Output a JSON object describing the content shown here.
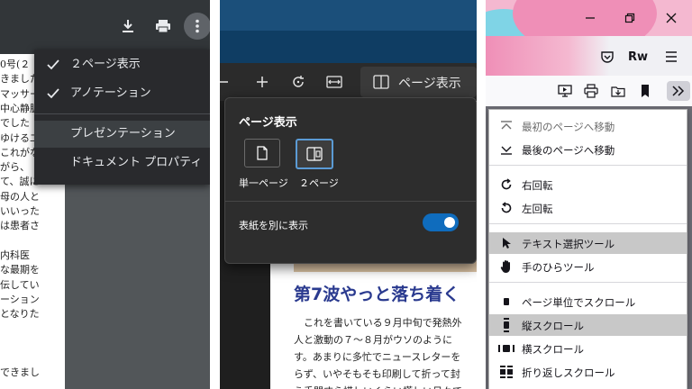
{
  "chrome_viewer": {
    "menu_items": [
      {
        "label": "２ページ表示",
        "checked": true
      },
      {
        "label": "アノテーション",
        "checked": true
      },
      {
        "label": "プレゼンテーション",
        "checked": false
      },
      {
        "label": "ドキュメント プロパティ",
        "checked": false
      }
    ],
    "doc_lines": [
      "0号(２",
      "きました",
      "マッサー",
      "中心静脈",
      "でした",
      "ゆける二",
      "これがな",
      "がら、",
      "て、誠に",
      "母の人と",
      "いいった",
      "は患者さ",
      "",
      "内科医",
      "な最期を",
      "伝してい",
      "ーション",
      "となりた",
      "",
      "",
      "",
      "できまし"
    ]
  },
  "edge_viewer": {
    "flyout_title": "ページ表示",
    "options": [
      {
        "label": "単一ページ",
        "selected": false
      },
      {
        "label": "２ページ",
        "selected": true
      }
    ],
    "cover_label": "表紙を別に表示",
    "cover_toggle_on": true,
    "toolbar_button_label": "ページ表示",
    "headline": "第7波やっと落ち着く",
    "doc_lines": [
      "　これを書いている９月中旬で発熱外",
      "人と激動の７～８月がウソのように",
      "す。あまりに多忙でニュースレターを",
      "らず、いやそもそも印刷して折って封",
      "う手間すら惜しいくらい慌しい日々で"
    ]
  },
  "firefox_viewer": {
    "menu_items": [
      {
        "label": "最初のページへ移動",
        "icon": "first-page-icon",
        "disabled": true,
        "highlighted": false
      },
      {
        "label": "最後のページへ移動",
        "icon": "last-page-icon",
        "disabled": false,
        "highlighted": false
      },
      {
        "label": "右回転",
        "icon": "rotate-cw-icon",
        "disabled": false,
        "highlighted": false
      },
      {
        "label": "左回転",
        "icon": "rotate-ccw-icon",
        "disabled": false,
        "highlighted": false
      },
      {
        "label": "テキスト選択ツール",
        "icon": "cursor-icon",
        "disabled": false,
        "highlighted": true
      },
      {
        "label": "手のひらツール",
        "icon": "hand-icon",
        "disabled": false,
        "highlighted": false
      },
      {
        "label": "ページ単位でスクロール",
        "icon": "page-scroll-icon",
        "disabled": false,
        "highlighted": false
      },
      {
        "label": "縦スクロール",
        "icon": "vertical-scroll-icon",
        "disabled": false,
        "highlighted": true
      },
      {
        "label": "横スクロール",
        "icon": "horizontal-scroll-icon",
        "disabled": false,
        "highlighted": false
      },
      {
        "label": "折り返しスクロール",
        "icon": "wrapped-scroll-icon",
        "disabled": false,
        "highlighted": false
      }
    ],
    "rw_badge": "Rw"
  }
}
